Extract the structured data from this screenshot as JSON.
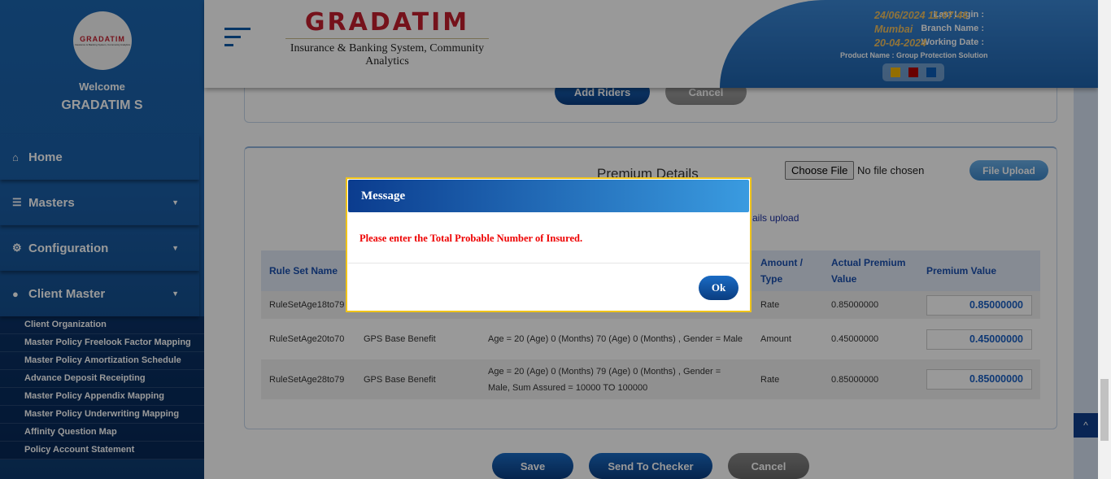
{
  "sidebar": {
    "logo_text": "GRADATIM",
    "logo_sub": "Insurance & Banking System, Community Analytics",
    "welcome": "Welcome",
    "user": "GRADATIM S",
    "menu": [
      {
        "label": "Home",
        "icon": "home-icon"
      },
      {
        "label": "Masters",
        "icon": "database-icon"
      },
      {
        "label": "Configuration",
        "icon": "gears-icon"
      },
      {
        "label": "Client Master",
        "icon": "user-icon"
      }
    ],
    "submenu": [
      "Client Organization",
      "Master Policy Freelook Factor Mapping",
      "Master Policy Amortization Schedule",
      "Advance Deposit Receipting",
      "Master Policy Appendix Mapping",
      "Master Policy Underwriting Mapping",
      "Affinity Question Map",
      "Policy Account Statement"
    ]
  },
  "header": {
    "logo_title": "GRADATIM",
    "logo_subtitle": "Insurance & Banking System, Community Analytics",
    "last_login_label": "Last Login :",
    "last_login": "24/06/2024 11:07:46",
    "branch_label": "Branch Name :",
    "branch": "Mumbai",
    "working_date_label": "Working Date :",
    "working_date": "20-04-2024",
    "product": "Product Name : Group Protection Solution",
    "theme_colors": [
      "#f5b800",
      "#b00000",
      "#0a5cb8"
    ]
  },
  "riders": {
    "add_riders": "Add Riders",
    "cancel": "Cancel"
  },
  "premium": {
    "title": "Premium Details",
    "choose_file": "Choose File",
    "no_file": "No file chosen",
    "file_upload": "File Upload",
    "upload_link": "ails upload",
    "headers": {
      "rule_set": "Rule Set Name",
      "amount_type": "Amount / Type",
      "actual": "Actual Premium Value",
      "premium_value": "Premium Value"
    },
    "rows": [
      {
        "rule": "RuleSetAge18to79",
        "benefit": "",
        "condition": "",
        "type": "Rate",
        "actual": "0.85000000",
        "value": "0.85000000"
      },
      {
        "rule": "RuleSetAge20to70",
        "benefit": "GPS Base Benefit",
        "condition": "Age = 20 (Age) 0 (Months) 70 (Age) 0 (Months) , Gender = Male",
        "type": "Amount",
        "actual": "0.45000000",
        "value": "0.45000000"
      },
      {
        "rule": "RuleSetAge28to79",
        "benefit": "GPS Base Benefit",
        "condition": "Age = 20 (Age) 0 (Months) 79 (Age) 0 (Months) , Gender = Male, Sum Assured = 10000 TO 100000",
        "type": "Rate",
        "actual": "0.85000000",
        "value": "0.85000000"
      }
    ]
  },
  "actions": {
    "save": "Save",
    "send": "Send To Checker",
    "cancel": "Cancel"
  },
  "modal": {
    "title": "Message",
    "message": "Please enter the Total Probable Number of Insured.",
    "ok": "Ok"
  }
}
